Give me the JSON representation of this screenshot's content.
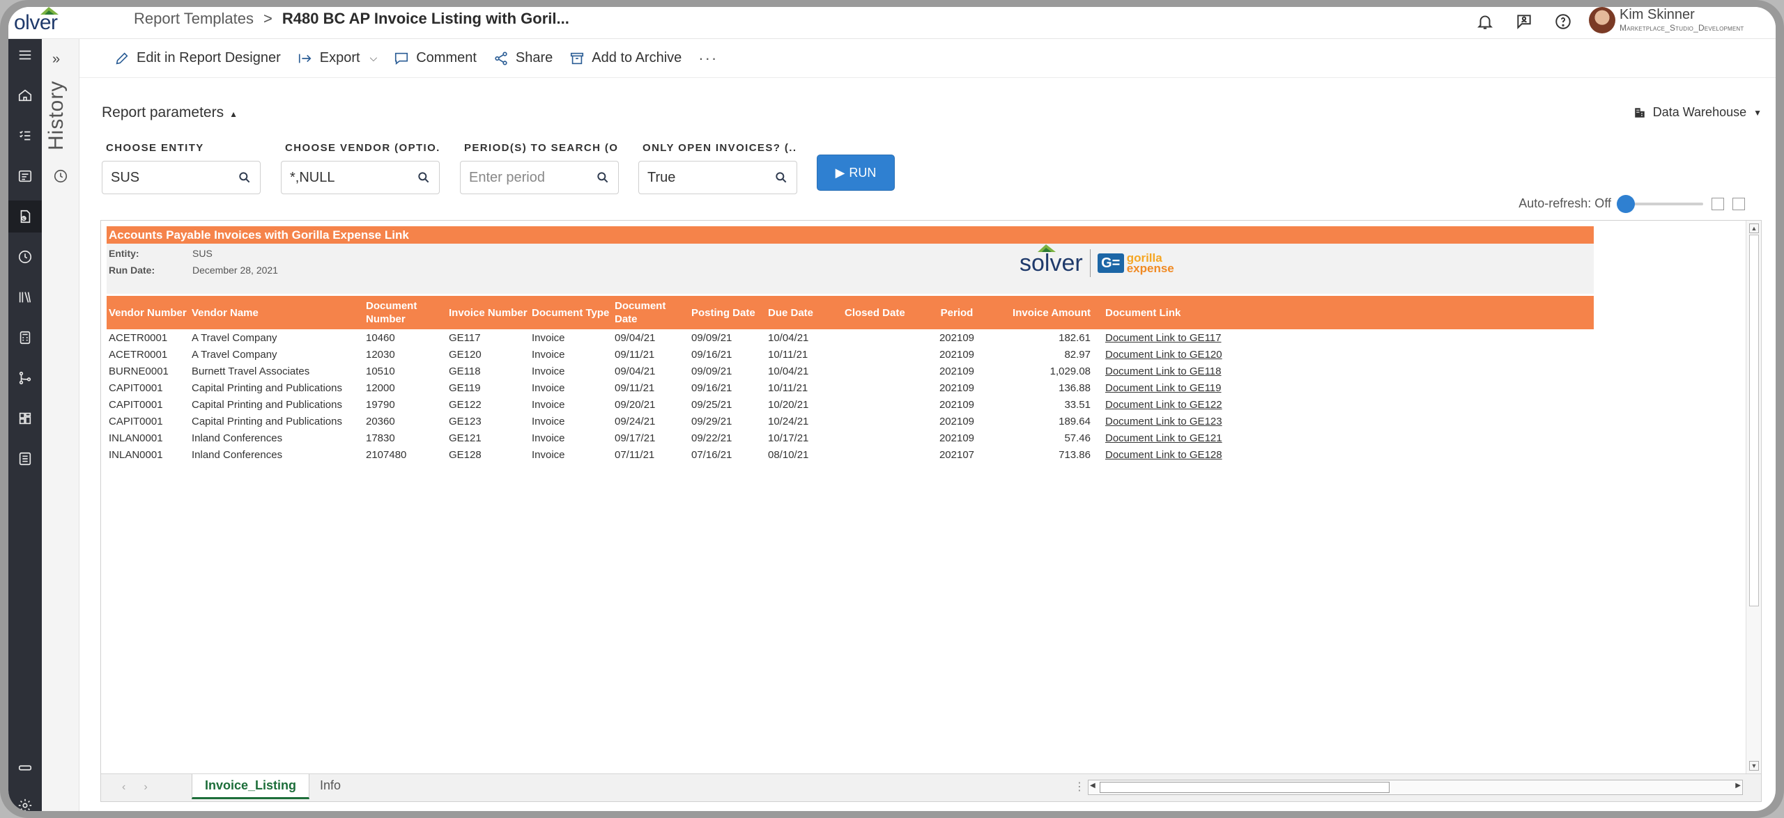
{
  "header": {
    "logo_text": "olver",
    "breadcrumb_parent": "Report Templates",
    "breadcrumb_separator": ">",
    "report_title": "R480 BC AP Invoice Listing with Goril...",
    "icons": [
      "bell-icon",
      "feedback-icon",
      "help-icon"
    ],
    "user_name": "Kim Skinner",
    "user_org": "Marketplace_Studio_Development"
  },
  "history": {
    "label": "History",
    "expand_glyph": "»"
  },
  "toolbar": {
    "edit": "Edit in Report Designer",
    "export": "Export",
    "comment": "Comment",
    "share": "Share",
    "archive": "Add to Archive",
    "more": "···"
  },
  "parameters": {
    "title": "Report parameters",
    "data_source": "Data Warehouse",
    "fields": [
      {
        "label": "CHOOSE ENTITY",
        "value": "SUS",
        "placeholder": ""
      },
      {
        "label": "CHOOSE VENDOR (OPTIO...",
        "value": "*,NULL",
        "placeholder": ""
      },
      {
        "label": "PERIOD(S) TO SEARCH (O...",
        "value": "",
        "placeholder": "Enter period"
      },
      {
        "label": "ONLY OPEN INVOICES? (...",
        "value": "True",
        "placeholder": ""
      }
    ],
    "run_label": "RUN",
    "auto_refresh": "Auto-refresh: Off"
  },
  "report": {
    "banner": "Accounts Payable Invoices with Gorilla Expense Link",
    "entity_label": "Entity:",
    "entity_value": "SUS",
    "run_date_label": "Run Date:",
    "run_date_value": "December 28, 2021",
    "brand_solver": "solver",
    "brand_gorilla_mark": "G=",
    "brand_gorilla_1": "gorilla",
    "brand_gorilla_2": "expense",
    "columns": [
      "Vendor Number",
      "Vendor Name",
      "Document Number",
      "Invoice Number",
      "Document Type",
      "Document Date",
      "Posting Date",
      "Due Date",
      "Closed Date",
      "Period",
      "Invoice Amount",
      "Document Link"
    ],
    "rows": [
      [
        "ACETR0001",
        "A Travel Company",
        "10460",
        "GE117",
        "Invoice",
        "09/04/21",
        "09/09/21",
        "10/04/21",
        "",
        "202109",
        "182.61",
        "Document Link to GE117"
      ],
      [
        "ACETR0001",
        "A Travel Company",
        "12030",
        "GE120",
        "Invoice",
        "09/11/21",
        "09/16/21",
        "10/11/21",
        "",
        "202109",
        "82.97",
        "Document Link to GE120"
      ],
      [
        "BURNE0001",
        "Burnett Travel Associates",
        "10510",
        "GE118",
        "Invoice",
        "09/04/21",
        "09/09/21",
        "10/04/21",
        "",
        "202109",
        "1,029.08",
        "Document Link to GE118"
      ],
      [
        "CAPIT0001",
        "Capital Printing and Publications",
        "12000",
        "GE119",
        "Invoice",
        "09/11/21",
        "09/16/21",
        "10/11/21",
        "",
        "202109",
        "136.88",
        "Document Link to GE119"
      ],
      [
        "CAPIT0001",
        "Capital Printing and Publications",
        "19790",
        "GE122",
        "Invoice",
        "09/20/21",
        "09/25/21",
        "10/20/21",
        "",
        "202109",
        "33.51",
        "Document Link to GE122"
      ],
      [
        "CAPIT0001",
        "Capital Printing and Publications",
        "20360",
        "GE123",
        "Invoice",
        "09/24/21",
        "09/29/21",
        "10/24/21",
        "",
        "202109",
        "189.64",
        "Document Link to GE123"
      ],
      [
        "INLAN0001",
        "Inland Conferences",
        "17830",
        "GE121",
        "Invoice",
        "09/17/21",
        "09/22/21",
        "10/17/21",
        "",
        "202109",
        "57.46",
        "Document Link to GE121"
      ],
      [
        "INLAN0001",
        "Inland Conferences",
        "2107480",
        "GE128",
        "Invoice",
        "07/11/21",
        "07/16/21",
        "08/10/21",
        "",
        "202107",
        "713.86",
        "Document Link to GE128"
      ]
    ]
  },
  "sheet_tabs": [
    "Invoice_Listing",
    "Info"
  ],
  "colors": {
    "accent_orange": "#f5834a",
    "run_blue": "#2f80d1",
    "rail_dark": "#2d3038",
    "tab_green": "#1d6e3a"
  }
}
